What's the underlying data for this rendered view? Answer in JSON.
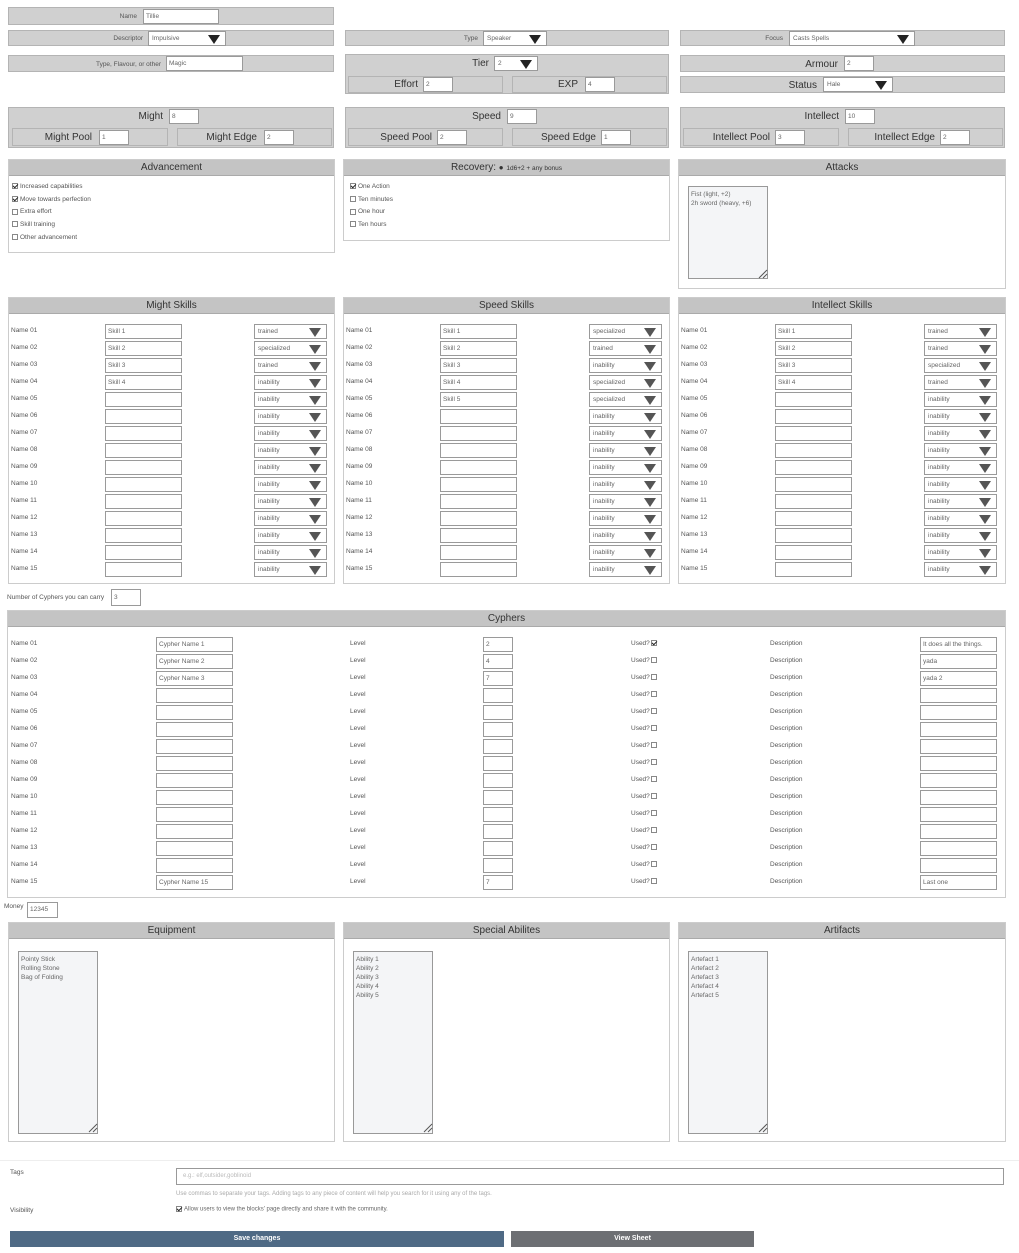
{
  "char": {
    "name_label": "Name",
    "name": "Tillie",
    "descriptor_label": "Descriptor",
    "descriptor": "Impulsive",
    "type_label": "Type",
    "type": "Speaker",
    "focus_label": "Focus",
    "focus": "Casts Spells",
    "flavour_label": "Type, Flavour, or other",
    "flavour": "Magic",
    "tier_label": "Tier",
    "tier": "2",
    "armour_label": "Armour",
    "armour": "2",
    "effort_label": "Effort",
    "effort": "2",
    "exp_label": "EXP",
    "exp": "4",
    "status_label": "Status",
    "status": "Hale"
  },
  "stats": [
    {
      "name": "Might",
      "value": "8",
      "pool_label": "Might Pool",
      "pool": "1",
      "edge_label": "Might Edge",
      "edge": "2"
    },
    {
      "name": "Speed",
      "value": "9",
      "pool_label": "Speed Pool",
      "pool": "2",
      "edge_label": "Speed Edge",
      "edge": "1"
    },
    {
      "name": "Intellect",
      "value": "10",
      "pool_label": "Intellect Pool",
      "pool": "3",
      "edge_label": "Intellect Edge",
      "edge": "2"
    }
  ],
  "advancement": {
    "title": "Advancement",
    "items": [
      {
        "label": "Increased capabilities",
        "checked": true
      },
      {
        "label": "Move towards perfection",
        "checked": true
      },
      {
        "label": "Extra effort",
        "checked": false
      },
      {
        "label": "Skill training",
        "checked": false
      },
      {
        "label": "Other advancement",
        "checked": false
      }
    ]
  },
  "recovery": {
    "title": "Recovery:",
    "roll": "1d6+2 + any bonus",
    "items": [
      {
        "label": "One Action",
        "checked": true
      },
      {
        "label": "Ten minutes",
        "checked": false
      },
      {
        "label": "One hour",
        "checked": false
      },
      {
        "label": "Ten hours",
        "checked": false
      }
    ]
  },
  "attacks": {
    "title": "Attacks",
    "text": "Fist (light, +2)\n2h sword (heavy, +6)"
  },
  "skills": [
    {
      "title": "Might Skills",
      "rows": [
        {
          "label": "Name 01",
          "skill": "Skill 1",
          "level": "trained"
        },
        {
          "label": "Name 02",
          "skill": "Skill 2",
          "level": "specialized"
        },
        {
          "label": "Name 03",
          "skill": "Skill 3",
          "level": "trained"
        },
        {
          "label": "Name 04",
          "skill": "Skill 4",
          "level": "inability"
        },
        {
          "label": "Name 05",
          "skill": "",
          "level": "inability"
        },
        {
          "label": "Name 06",
          "skill": "",
          "level": "inability"
        },
        {
          "label": "Name 07",
          "skill": "",
          "level": "inability"
        },
        {
          "label": "Name 08",
          "skill": "",
          "level": "inability"
        },
        {
          "label": "Name 09",
          "skill": "",
          "level": "inability"
        },
        {
          "label": "Name 10",
          "skill": "",
          "level": "inability"
        },
        {
          "label": "Name 11",
          "skill": "",
          "level": "inability"
        },
        {
          "label": "Name 12",
          "skill": "",
          "level": "inability"
        },
        {
          "label": "Name 13",
          "skill": "",
          "level": "inability"
        },
        {
          "label": "Name 14",
          "skill": "",
          "level": "inability"
        },
        {
          "label": "Name 15",
          "skill": "",
          "level": "inability"
        }
      ]
    },
    {
      "title": "Speed Skills",
      "rows": [
        {
          "label": "Name 01",
          "skill": "Skill 1",
          "level": "specialized"
        },
        {
          "label": "Name 02",
          "skill": "Skill 2",
          "level": "trained"
        },
        {
          "label": "Name 03",
          "skill": "Skill 3",
          "level": "inability"
        },
        {
          "label": "Name 04",
          "skill": "Skill 4",
          "level": "specialized"
        },
        {
          "label": "Name 05",
          "skill": "Skill 5",
          "level": "specialized"
        },
        {
          "label": "Name 06",
          "skill": "",
          "level": "inability"
        },
        {
          "label": "Name 07",
          "skill": "",
          "level": "inability"
        },
        {
          "label": "Name 08",
          "skill": "",
          "level": "inability"
        },
        {
          "label": "Name 09",
          "skill": "",
          "level": "inability"
        },
        {
          "label": "Name 10",
          "skill": "",
          "level": "inability"
        },
        {
          "label": "Name 11",
          "skill": "",
          "level": "inability"
        },
        {
          "label": "Name 12",
          "skill": "",
          "level": "inability"
        },
        {
          "label": "Name 13",
          "skill": "",
          "level": "inability"
        },
        {
          "label": "Name 14",
          "skill": "",
          "level": "inability"
        },
        {
          "label": "Name 15",
          "skill": "",
          "level": "inability"
        }
      ]
    },
    {
      "title": "Intellect Skills",
      "rows": [
        {
          "label": "Name 01",
          "skill": "Skill 1",
          "level": "trained"
        },
        {
          "label": "Name 02",
          "skill": "Skill 2",
          "level": "trained"
        },
        {
          "label": "Name 03",
          "skill": "Skill 3",
          "level": "specialized"
        },
        {
          "label": "Name 04",
          "skill": "Skill 4",
          "level": "trained"
        },
        {
          "label": "Name 05",
          "skill": "",
          "level": "inability"
        },
        {
          "label": "Name 06",
          "skill": "",
          "level": "inability"
        },
        {
          "label": "Name 07",
          "skill": "",
          "level": "inability"
        },
        {
          "label": "Name 08",
          "skill": "",
          "level": "inability"
        },
        {
          "label": "Name 09",
          "skill": "",
          "level": "inability"
        },
        {
          "label": "Name 10",
          "skill": "",
          "level": "inability"
        },
        {
          "label": "Name 11",
          "skill": "",
          "level": "inability"
        },
        {
          "label": "Name 12",
          "skill": "",
          "level": "inability"
        },
        {
          "label": "Name 13",
          "skill": "",
          "level": "inability"
        },
        {
          "label": "Name 14",
          "skill": "",
          "level": "inability"
        },
        {
          "label": "Name 15",
          "skill": "",
          "level": "inability"
        }
      ]
    }
  ],
  "cypher_carry": {
    "label": "Number of Cyphers you can carry",
    "value": "3"
  },
  "cyphers": {
    "title": "Cyphers",
    "level_label": "Level",
    "used_label": "Used?",
    "desc_label": "Description",
    "rows": [
      {
        "label": "Name 01",
        "name": "Cypher Name 1",
        "level": "2",
        "used": true,
        "desc": "It does all the things."
      },
      {
        "label": "Name 02",
        "name": "Cypher Name 2",
        "level": "4",
        "used": false,
        "desc": "yada"
      },
      {
        "label": "Name 03",
        "name": "Cypher Name 3",
        "level": "7",
        "used": false,
        "desc": "yada 2"
      },
      {
        "label": "Name 04",
        "name": "",
        "level": "",
        "used": false,
        "desc": ""
      },
      {
        "label": "Name 05",
        "name": "",
        "level": "",
        "used": false,
        "desc": ""
      },
      {
        "label": "Name 06",
        "name": "",
        "level": "",
        "used": false,
        "desc": ""
      },
      {
        "label": "Name 07",
        "name": "",
        "level": "",
        "used": false,
        "desc": ""
      },
      {
        "label": "Name 08",
        "name": "",
        "level": "",
        "used": false,
        "desc": ""
      },
      {
        "label": "Name 09",
        "name": "",
        "level": "",
        "used": false,
        "desc": ""
      },
      {
        "label": "Name 10",
        "name": "",
        "level": "",
        "used": false,
        "desc": ""
      },
      {
        "label": "Name 11",
        "name": "",
        "level": "",
        "used": false,
        "desc": ""
      },
      {
        "label": "Name 12",
        "name": "",
        "level": "",
        "used": false,
        "desc": ""
      },
      {
        "label": "Name 13",
        "name": "",
        "level": "",
        "used": false,
        "desc": ""
      },
      {
        "label": "Name 14",
        "name": "",
        "level": "",
        "used": false,
        "desc": ""
      },
      {
        "label": "Name 15",
        "name": "Cypher Name 15",
        "level": "7",
        "used": false,
        "desc": "Last one"
      }
    ]
  },
  "money": {
    "label": "Money",
    "value": "12345"
  },
  "bottom_panels": [
    {
      "title": "Equipment",
      "text": "Pointy Stick\nRolling Stone\nBag of Folding"
    },
    {
      "title": "Special Abilites",
      "text": "Ability 1\nAbility 2\nAbility 3\nAbility 4\nAbility 5"
    },
    {
      "title": "Artifacts",
      "text": "Artefact 1\nArtefact 2\nArtefact 3\nArtefact 4\nArtefact 5"
    }
  ],
  "tags": {
    "label": "Tags",
    "placeholder": "e.g.: elf,outsider,goblinoid",
    "help": "Use commas to separate your tags. Adding tags to any piece of content will help you search for it using any of the tags."
  },
  "visibility": {
    "label": "Visibility",
    "text": "Allow users to view the blocks' page directly and share it with the community.",
    "checked": true
  },
  "buttons": {
    "save": "Save changes",
    "view": "View Sheet"
  },
  "colors": {
    "save_bg": "#4f6a85",
    "view_bg": "#6d6f73",
    "header_bg": "#c4c4c4",
    "bar_bg": "#d0d0d0"
  }
}
